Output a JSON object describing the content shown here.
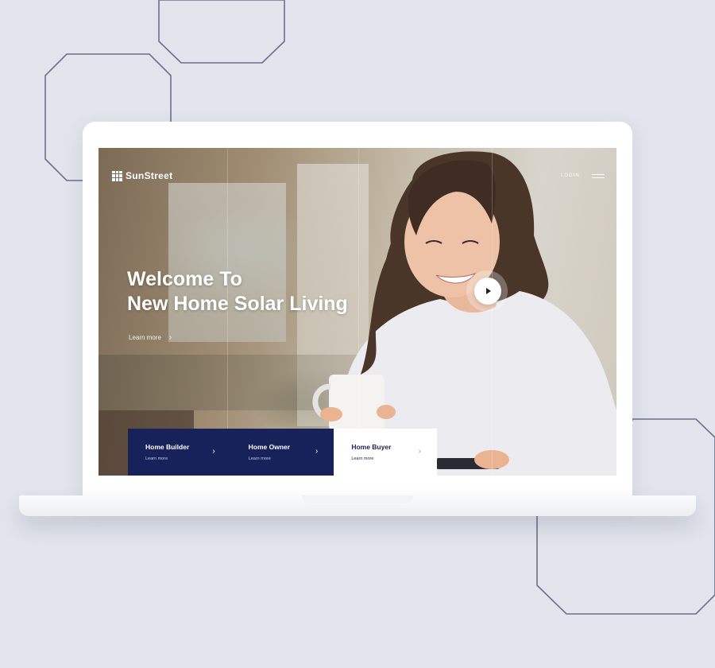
{
  "brand": {
    "name": "SunStreet"
  },
  "header": {
    "login_label": "LOGIN"
  },
  "hero": {
    "title_line1": "Welcome To",
    "title_line2": "New Home Solar Living",
    "learn_more": "Learn more"
  },
  "cards": [
    {
      "title": "Home Builder",
      "link": "Learn more",
      "style": "dark"
    },
    {
      "title": "Home Owner",
      "link": "Learn more",
      "style": "dark"
    },
    {
      "title": "Home Buyer",
      "link": "Learn more",
      "style": "light"
    }
  ],
  "icons": {
    "logo": "solar-panel-grid-icon",
    "menu": "hamburger-menu-icon",
    "play": "play-icon",
    "chevron": "chevron-right-icon"
  },
  "colors": {
    "background": "#e2e5ec",
    "navy": "#17215a",
    "outline": "#6b6f8e"
  }
}
